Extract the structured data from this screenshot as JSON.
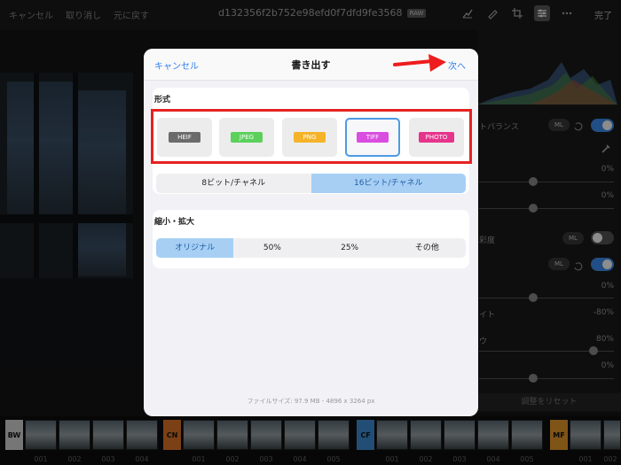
{
  "topbar": {
    "cancel": "キャンセル",
    "undo": "取り消し",
    "revert": "元に戻す",
    "filename": "d132356f2b752e98efd0f7dfd9fe3568",
    "raw_badge": "RAW",
    "done": "完了"
  },
  "dialog": {
    "cancel": "キャンセル",
    "title": "書き出す",
    "next": "次へ",
    "format_section": "形式",
    "formats": [
      {
        "label": "HEIF",
        "color": "#6b6b6b",
        "selected": false
      },
      {
        "label": "JPEG",
        "color": "#5cd05c",
        "selected": false
      },
      {
        "label": "PNG",
        "color": "#f5b32a",
        "selected": false
      },
      {
        "label": "TIFF",
        "color": "#d94de0",
        "selected": true
      },
      {
        "label": "PHOTO",
        "color": "#e6348c",
        "selected": false
      }
    ],
    "bitdepth": {
      "options": [
        "8ビット/チャネル",
        "16ビット/チャネル"
      ],
      "selected": "16ビット/チャネル"
    },
    "resize_section": "縮小・拡大",
    "resize": {
      "options": [
        "オリジナル",
        "50%",
        "25%",
        "その他"
      ],
      "selected": "オリジナル"
    },
    "footer": "ファイルサイズ: 97.9 MB - 4896 x 3264 px"
  },
  "panel": {
    "white_balance": "トバランス",
    "ml": "ML",
    "saturation_fragment": "彩度",
    "pct_0a": "0%",
    "pct_0b": "0%",
    "pct_0c": "0%",
    "pct_m80": "-80%",
    "pct_80": "80%",
    "pct_0d": "0%",
    "frag_ito": "イト",
    "frag_u": "ウ",
    "reset": "調整をリセット"
  },
  "filmstrip": {
    "tags": [
      {
        "label": "BW",
        "color": "#d8d8d8"
      },
      {
        "label": "CN",
        "color": "#e2752a"
      },
      {
        "label": "CF",
        "color": "#3f8fd6"
      },
      {
        "label": "MF",
        "color": "#e89a2a"
      }
    ],
    "numbers": [
      "001",
      "002",
      "003",
      "004",
      "001",
      "002",
      "003",
      "004",
      "005",
      "001",
      "002",
      "003",
      "004",
      "005",
      "001",
      "002"
    ]
  },
  "colors": {
    "accent": "#2f7ef1",
    "highlight_box": "#e52222",
    "arrow": "#ee1c1c"
  }
}
